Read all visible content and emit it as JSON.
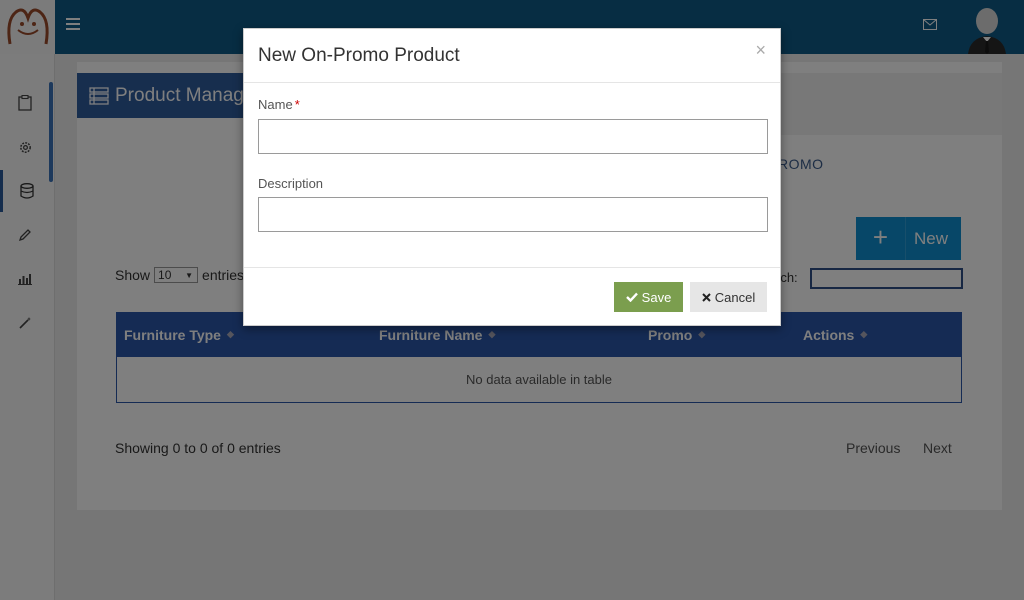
{
  "header": {
    "menu_icon": "hamburger-icon",
    "mail_icon": "mail-icon",
    "avatar_icon": "user-avatar"
  },
  "sidebar": {
    "items": [
      {
        "icon": "clipboard-icon"
      },
      {
        "icon": "gear-icon"
      },
      {
        "icon": "database-icon",
        "active": true
      },
      {
        "icon": "pencil-icon"
      },
      {
        "icon": "bar-chart-icon"
      },
      {
        "icon": "magic-wand-icon"
      }
    ]
  },
  "panel": {
    "title": "Product Manag",
    "promo_heading": "ROMO",
    "new_button": "New"
  },
  "table_controls": {
    "show_prefix": "Show",
    "show_value": "10",
    "show_suffix": "entries",
    "search_label": "rch:"
  },
  "table": {
    "columns": [
      "Furniture Type",
      "Furniture Name",
      "Promo",
      "Actions"
    ],
    "empty_text": "No data available in table"
  },
  "footer": {
    "info": "Showing 0 to 0 of 0 entries",
    "previous": "Previous",
    "next": "Next"
  },
  "modal": {
    "title": "New On-Promo Product",
    "close_glyph": "×",
    "name_label": "Name",
    "required_mark": "*",
    "name_value": "",
    "description_label": "Description",
    "description_value": "",
    "save_label": "Save",
    "cancel_label": "Cancel"
  },
  "colors": {
    "topbar": "#0f5a86",
    "panel_header": "#2f5c9d",
    "table_header": "#2a56a8",
    "new_button": "#0e8fd0",
    "save_button": "#7b9e4e",
    "cancel_button": "#e6e6e6"
  }
}
